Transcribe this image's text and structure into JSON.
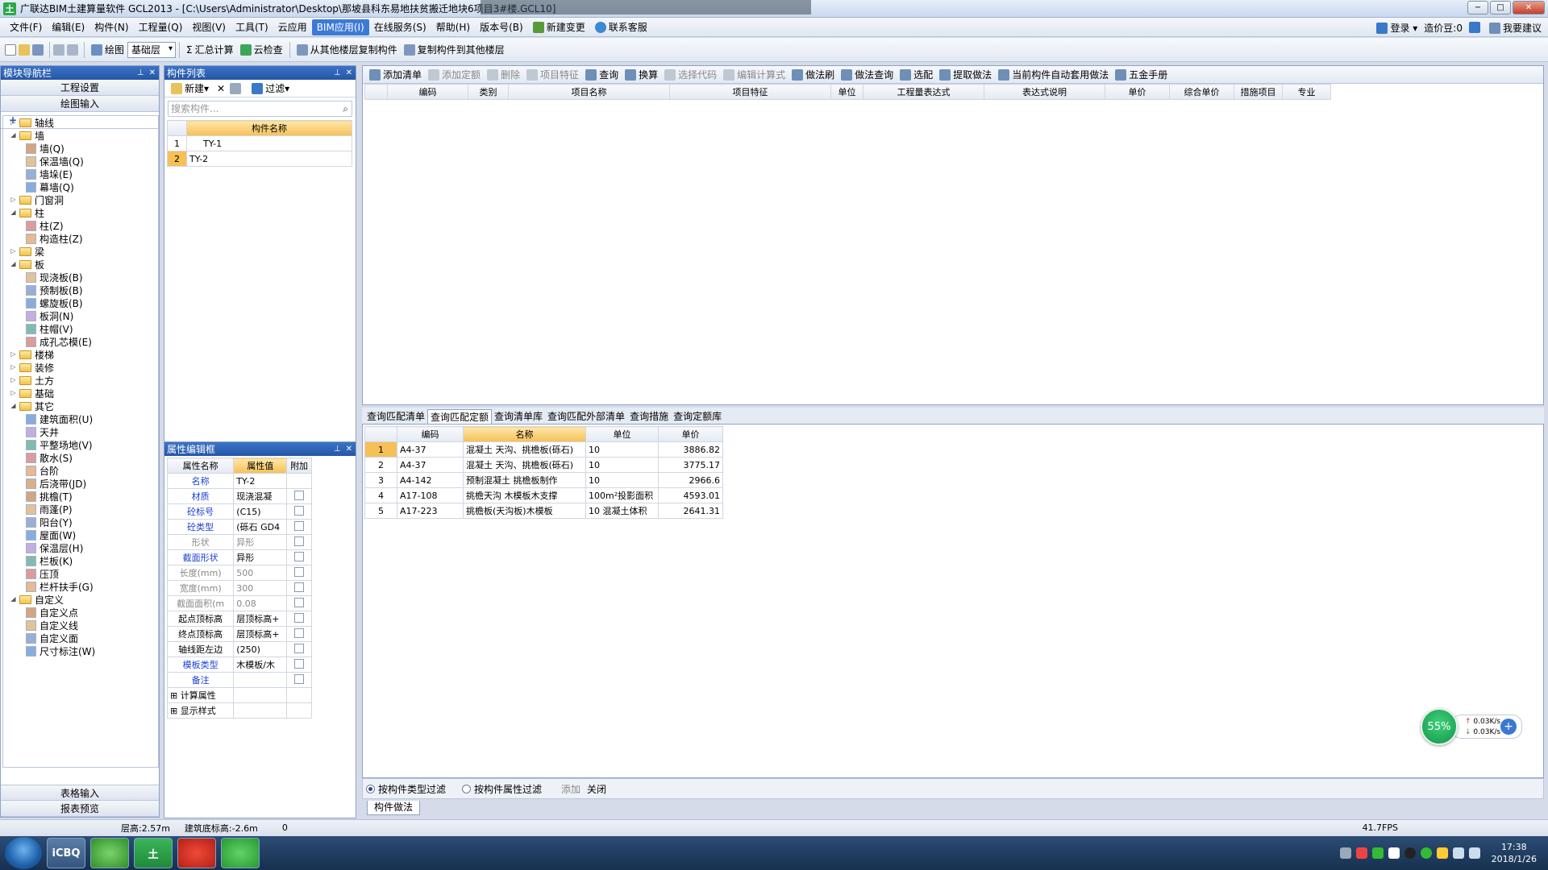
{
  "window": {
    "title": "广联达BIM土建算量软件 GCL2013 - [C:\\Users\\Administrator\\Desktop\\那坡县科东易地扶贫搬迁地块6项目3#楼.GCL10]",
    "min": "−",
    "max": "□",
    "close": "✕"
  },
  "menu": {
    "items": [
      "文件(F)",
      "编辑(E)",
      "构件(N)",
      "工程量(Q)",
      "视图(V)",
      "工具(T)",
      "云应用",
      "BIM应用(I)",
      "在线服务(S)",
      "帮助(H)",
      "版本号(B)"
    ],
    "extra": [
      "新建变更",
      "联系客服"
    ],
    "right": {
      "login": "登录",
      "price": "造价豆:0",
      "suggest": "我要建议"
    }
  },
  "toolbar": {
    "draw": "绘图",
    "floor": "基础层",
    "sum": "汇总计算",
    "cloud_check": "云检查",
    "copy_from": "从其他楼层复制构件",
    "copy_to": "复制构件到其他楼层"
  },
  "nav": {
    "title": "模块导航栏",
    "btn_project": "工程设置",
    "btn_draw": "绘图输入",
    "btn_table": "表格输入",
    "btn_report": "报表预览",
    "add": "+",
    "remove": "−",
    "tree": [
      {
        "label": "轴线",
        "level": 0,
        "exp": "▷",
        "folder": true
      },
      {
        "label": "墙",
        "level": 0,
        "exp": "◢",
        "folder": true
      },
      {
        "label": "墙(Q)",
        "level": 1
      },
      {
        "label": "保温墙(Q)",
        "level": 1
      },
      {
        "label": "墙垛(E)",
        "level": 1
      },
      {
        "label": "幕墙(Q)",
        "level": 1
      },
      {
        "label": "门窗洞",
        "level": 0,
        "exp": "▷",
        "folder": true
      },
      {
        "label": "柱",
        "level": 0,
        "exp": "◢",
        "folder": true
      },
      {
        "label": "柱(Z)",
        "level": 1
      },
      {
        "label": "构造柱(Z)",
        "level": 1
      },
      {
        "label": "梁",
        "level": 0,
        "exp": "▷",
        "folder": true
      },
      {
        "label": "板",
        "level": 0,
        "exp": "◢",
        "folder": true
      },
      {
        "label": "现浇板(B)",
        "level": 1
      },
      {
        "label": "预制板(B)",
        "level": 1
      },
      {
        "label": "螺旋板(B)",
        "level": 1
      },
      {
        "label": "板洞(N)",
        "level": 1
      },
      {
        "label": "柱帽(V)",
        "level": 1
      },
      {
        "label": "成孔芯模(E)",
        "level": 1
      },
      {
        "label": "楼梯",
        "level": 0,
        "exp": "▷",
        "folder": true
      },
      {
        "label": "装修",
        "level": 0,
        "exp": "▷",
        "folder": true
      },
      {
        "label": "土方",
        "level": 0,
        "exp": "▷",
        "folder": true
      },
      {
        "label": "基础",
        "level": 0,
        "exp": "▷",
        "folder": true
      },
      {
        "label": "其它",
        "level": 0,
        "exp": "◢",
        "folder": true
      },
      {
        "label": "建筑面积(U)",
        "level": 1
      },
      {
        "label": "天井",
        "level": 1
      },
      {
        "label": "平整场地(V)",
        "level": 1
      },
      {
        "label": "散水(S)",
        "level": 1
      },
      {
        "label": "台阶",
        "level": 1
      },
      {
        "label": "后浇带(JD)",
        "level": 1
      },
      {
        "label": "挑檐(T)",
        "level": 1
      },
      {
        "label": "雨蓬(P)",
        "level": 1
      },
      {
        "label": "阳台(Y)",
        "level": 1
      },
      {
        "label": "屋面(W)",
        "level": 1
      },
      {
        "label": "保温层(H)",
        "level": 1
      },
      {
        "label": "栏板(K)",
        "level": 1
      },
      {
        "label": "压顶",
        "level": 1
      },
      {
        "label": "栏杆扶手(G)",
        "level": 1
      },
      {
        "label": "自定义",
        "level": 0,
        "exp": "◢",
        "folder": true
      },
      {
        "label": "自定义点",
        "level": 1
      },
      {
        "label": "自定义线",
        "level": 1
      },
      {
        "label": "自定义面",
        "level": 1
      },
      {
        "label": "尺寸标注(W)",
        "level": 1
      }
    ]
  },
  "components": {
    "title": "构件列表",
    "new": "新建",
    "filter": "过滤",
    "search_placeholder": "搜索构件...",
    "col_name": "构件名称",
    "rows": [
      {
        "no": "1",
        "name": "TY-1"
      },
      {
        "no": "2",
        "name": "TY-2"
      }
    ]
  },
  "props": {
    "title": "属性编辑框",
    "col_name": "属性名称",
    "col_value": "属性值",
    "col_extra": "附加",
    "rows": [
      {
        "name": "名称",
        "value": "TY-2",
        "style": "blue",
        "cb": false
      },
      {
        "name": "材质",
        "value": "现浇混凝",
        "style": "blue",
        "cb": true
      },
      {
        "name": "砼标号",
        "value": "(C15)",
        "style": "blue",
        "cb": true
      },
      {
        "name": "砼类型",
        "value": "(砾石 GD4",
        "style": "blue",
        "cb": true
      },
      {
        "name": "形状",
        "value": "异形",
        "style": "gray",
        "cb": true
      },
      {
        "name": "截面形状",
        "value": "异形",
        "style": "blue",
        "cb": true
      },
      {
        "name": "长度(mm)",
        "value": "500",
        "style": "gray",
        "cb": true
      },
      {
        "name": "宽度(mm)",
        "value": "300",
        "style": "gray",
        "cb": true
      },
      {
        "name": "截面面积(m",
        "value": "0.08",
        "style": "gray",
        "cb": true
      },
      {
        "name": "起点顶标高",
        "value": "层顶标高+",
        "style": "",
        "cb": true
      },
      {
        "name": "终点顶标高",
        "value": "层顶标高+",
        "style": "",
        "cb": true
      },
      {
        "name": "轴线距左边",
        "value": "(250)",
        "style": "",
        "cb": true
      },
      {
        "name": "模板类型",
        "value": "木模板/木",
        "style": "blue",
        "cb": true
      },
      {
        "name": "备注",
        "value": "",
        "style": "blue",
        "cb": true
      }
    ],
    "groups": [
      "计算属性",
      "显示样式"
    ]
  },
  "work": {
    "toolbar": [
      "添加清单",
      "添加定额",
      "删除",
      "项目特征",
      "查询",
      "换算",
      "选择代码",
      "编辑计算式",
      "做法刷",
      "做法查询",
      "选配",
      "提取做法",
      "当前构件自动套用做法",
      "五金手册"
    ],
    "columns": [
      "编码",
      "类别",
      "项目名称",
      "项目特征",
      "单位",
      "工程量表达式",
      "表达式说明",
      "单价",
      "综合单价",
      "措施项目",
      "专业"
    ]
  },
  "query": {
    "tabs": [
      "查询匹配清单",
      "查询匹配定额",
      "查询清单库",
      "查询匹配外部清单",
      "查询措施",
      "查询定额库"
    ],
    "active_tab": 1,
    "columns": [
      "编码",
      "名称",
      "单位",
      "单价"
    ],
    "rows": [
      {
        "no": "1",
        "code": "A4-37",
        "name": "混凝土 天沟、挑檐板(砾石)",
        "unit": "10",
        "price": "3886.82"
      },
      {
        "no": "2",
        "code": "A4-37",
        "name": "混凝土 天沟、挑檐板(砾石)",
        "unit": "10",
        "price": "3775.17"
      },
      {
        "no": "3",
        "code": "A4-142",
        "name": "预制混凝土 挑檐板制作",
        "unit": "10",
        "price": "2966.6"
      },
      {
        "no": "4",
        "code": "A17-108",
        "name": "挑檐天沟 木模板木支撑",
        "unit": "100m²投影面积",
        "price": "4593.01"
      },
      {
        "no": "5",
        "code": "A17-223",
        "name": "挑檐板(天沟板)木模板",
        "unit": "10  混凝土体积",
        "price": "2641.31"
      }
    ],
    "filter_type": "按构件类型过滤",
    "filter_prop": "按构件属性过滤",
    "add": "添加",
    "close": "关闭",
    "bottom_tab": "构件做法"
  },
  "status": {
    "floor_h": "层高:2.57m",
    "base_h": "建筑底标高:-2.6m",
    "zero": "0",
    "fps": "41.7FPS"
  },
  "speed": {
    "percent": "55%",
    "up": "0.03K/s",
    "down": "0.03K/s"
  },
  "taskbar": {
    "time": "17:38",
    "date": "2018/1/26",
    "app1": "iCBQ"
  },
  "colors": {
    "accent": "#3d7ad6",
    "highlight": "#f6c057"
  }
}
